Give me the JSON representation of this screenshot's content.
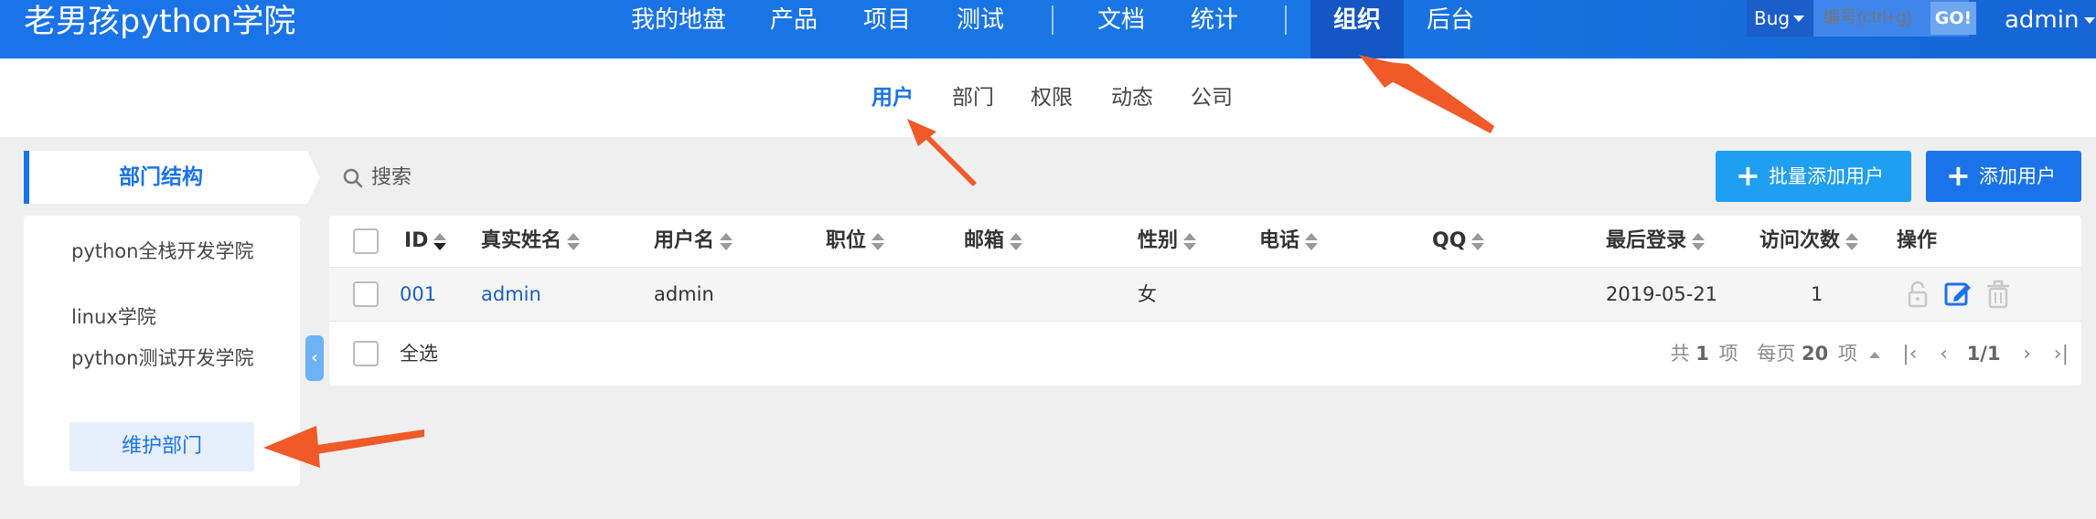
{
  "header": {
    "brand": "老男孩python学院",
    "nav": [
      "我的地盘",
      "产品",
      "项目",
      "测试",
      "文档",
      "统计",
      "组织",
      "后台"
    ],
    "active_nav": "组织",
    "search": {
      "type": "Bug",
      "placeholder": "编号(ctrl+g)",
      "go_label": "GO!"
    },
    "user": "admin"
  },
  "subnav": {
    "items": [
      "用户",
      "部门",
      "权限",
      "动态",
      "公司"
    ],
    "active": "用户"
  },
  "left": {
    "title": "部门结构",
    "departments": [
      "python全栈开发学院",
      "linux学院",
      "python测试开发学院"
    ],
    "maintain_label": "维护部门"
  },
  "toolbar": {
    "search_label": "搜索",
    "batch_add_label": "批量添加用户",
    "add_label": "添加用户"
  },
  "table": {
    "headers": [
      "ID",
      "真实姓名",
      "用户名",
      "职位",
      "邮箱",
      "性别",
      "电话",
      "QQ",
      "最后登录",
      "访问次数",
      "操作"
    ],
    "rows": [
      {
        "id": "001",
        "realname": "admin",
        "username": "admin",
        "position": "",
        "email": "",
        "gender": "女",
        "phone": "",
        "qq": "",
        "last_login": "2019-05-21",
        "visits": "1"
      }
    ],
    "select_all_label": "全选"
  },
  "pager": {
    "total_prefix": "共",
    "total": "1",
    "total_suffix": "项",
    "per_page_prefix": "每页",
    "per_page": "20",
    "per_page_suffix": "项",
    "page": "1/1"
  },
  "colors": {
    "primary": "#1a73e8",
    "header_bg": "#1a73e8",
    "annotation": "#f05a28"
  }
}
